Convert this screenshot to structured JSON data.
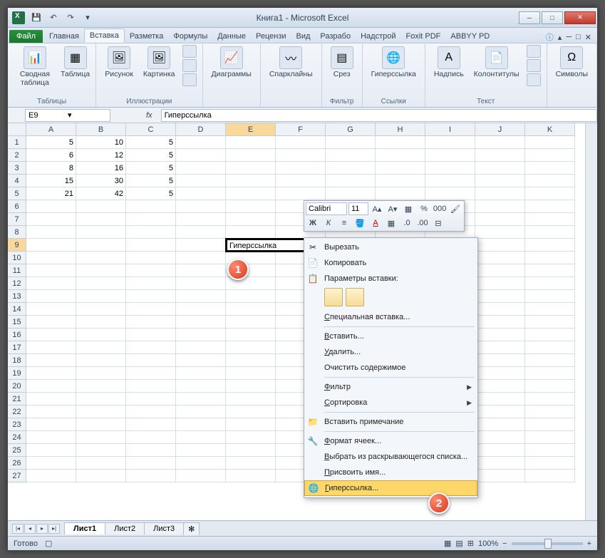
{
  "titlebar": {
    "app_title": "Книга1 - Microsoft Excel"
  },
  "ribbon_tabs": {
    "file": "Файл",
    "items": [
      "Главная",
      "Вставка",
      "Разметка",
      "Формулы",
      "Данные",
      "Рецензи",
      "Вид",
      "Разрабо",
      "Надстрой",
      "Foxit PDF",
      "ABBYY PD"
    ],
    "active_index": 1
  },
  "ribbon": {
    "groups": [
      {
        "label": "Таблицы",
        "buttons": [
          {
            "label": "Сводная таблица",
            "icon": "📊"
          },
          {
            "label": "Таблица",
            "icon": "▦"
          }
        ]
      },
      {
        "label": "Иллюстрации",
        "buttons": [
          {
            "label": "Рисунок",
            "icon": "🖼"
          },
          {
            "label": "Картинка",
            "icon": "🖼"
          }
        ],
        "small": true
      },
      {
        "label": "",
        "buttons": [
          {
            "label": "Диаграммы",
            "icon": "📈"
          }
        ]
      },
      {
        "label": "",
        "buttons": [
          {
            "label": "Спарклайны",
            "icon": "〰"
          }
        ]
      },
      {
        "label": "Фильтр",
        "buttons": [
          {
            "label": "Срез",
            "icon": "▤"
          }
        ]
      },
      {
        "label": "Ссылки",
        "buttons": [
          {
            "label": "Гиперссылка",
            "icon": "🌐"
          }
        ]
      },
      {
        "label": "Текст",
        "buttons": [
          {
            "label": "Надпись",
            "icon": "A"
          },
          {
            "label": "Колонтитулы",
            "icon": "📄"
          }
        ],
        "small": true
      },
      {
        "label": "",
        "buttons": [
          {
            "label": "Символы",
            "icon": "Ω"
          }
        ]
      }
    ]
  },
  "formula_bar": {
    "name_box": "E9",
    "formula": "Гиперссылка"
  },
  "grid": {
    "columns": [
      "A",
      "B",
      "C",
      "D",
      "E",
      "F",
      "G",
      "H",
      "I",
      "J",
      "K"
    ],
    "selected_col": 4,
    "selected_row": 8,
    "rows": 27,
    "data": [
      [
        "5",
        "10",
        "5"
      ],
      [
        "6",
        "12",
        "5"
      ],
      [
        "8",
        "16",
        "5"
      ],
      [
        "15",
        "30",
        "5"
      ],
      [
        "21",
        "42",
        "5"
      ]
    ],
    "selected_cell_value": "Гиперссылка"
  },
  "mini_toolbar": {
    "font": "Calibri",
    "size": "11"
  },
  "context_menu": {
    "items": [
      {
        "label": "Вырезать",
        "icon": "✂"
      },
      {
        "label": "Копировать",
        "icon": "📄"
      },
      {
        "label": "Параметры вставки:",
        "icon": "📋",
        "header": true
      },
      {
        "paste_opts": true
      },
      {
        "label": "Специальная вставка...",
        "u": 0
      },
      {
        "sep": true
      },
      {
        "label": "Вставить...",
        "u": 0
      },
      {
        "label": "Удалить...",
        "u": 0
      },
      {
        "label": "Очистить содержимое"
      },
      {
        "sep": true
      },
      {
        "label": "Фильтр",
        "arrow": true,
        "u": 0
      },
      {
        "label": "Сортировка",
        "arrow": true,
        "u": 0
      },
      {
        "sep": true
      },
      {
        "label": "Вставить примечание",
        "icon": "📁"
      },
      {
        "sep": true
      },
      {
        "label": "Формат ячеек...",
        "icon": "🔧",
        "u": 0
      },
      {
        "label": "Выбрать из раскрывающегося списка...",
        "u": 0
      },
      {
        "label": "Присвоить имя...",
        "u": 0
      },
      {
        "label": "Гиперссылка...",
        "icon": "🌐",
        "u": 0,
        "highlight": true
      }
    ]
  },
  "sheet_tabs": {
    "sheets": [
      "Лист1",
      "Лист2",
      "Лист3"
    ],
    "active": 0
  },
  "statusbar": {
    "status": "Готово",
    "zoom": "100%"
  },
  "callouts": {
    "c1": "1",
    "c2": "2"
  }
}
